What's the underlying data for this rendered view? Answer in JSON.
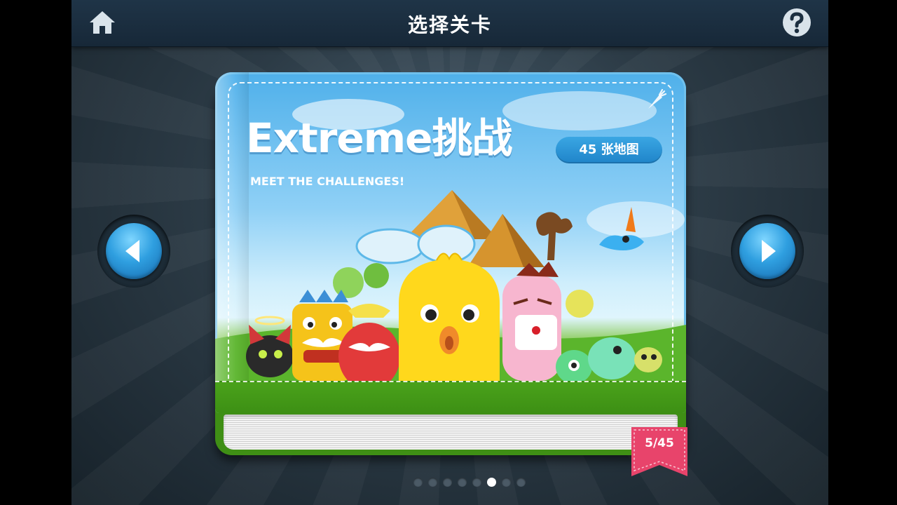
{
  "header": {
    "title": "选择关卡",
    "home_icon": "home-icon",
    "help_icon": "help-icon"
  },
  "book": {
    "title": "Extreme挑战",
    "subtitle": "MEET THE CHALLENGES!",
    "map_count_badge": "45 张地图",
    "page_indicator": "5/45",
    "decor_icon": "carrot-icon"
  },
  "navigation": {
    "prev_icon": "arrow-left-icon",
    "next_icon": "arrow-right-icon",
    "page_dots_total": 8,
    "page_dots_active_index": 5
  },
  "colors": {
    "accent_blue": "#2f9fe0",
    "cover_green": "#4aa21b",
    "ribbon_pink": "#e8446b",
    "top_bar": "#1a2d3e"
  }
}
